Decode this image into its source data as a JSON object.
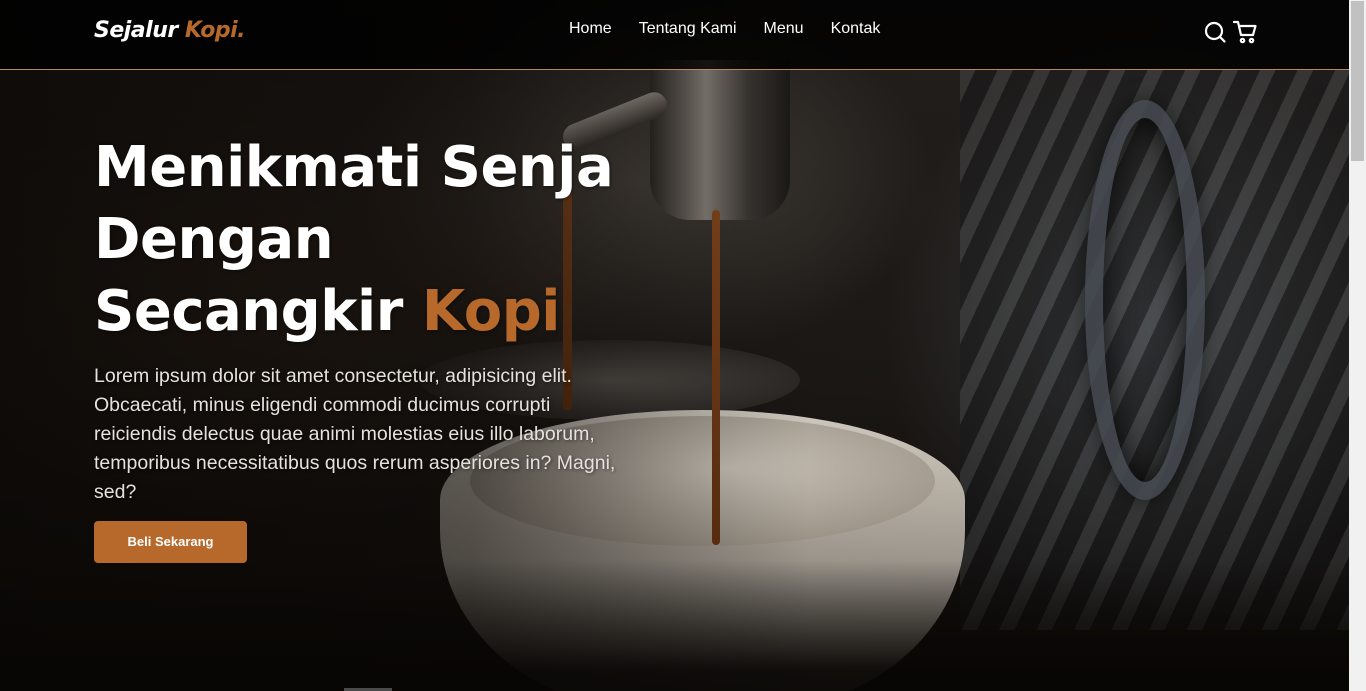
{
  "navbar": {
    "brand": {
      "main": "Sejalur",
      "accent": "Kopi."
    },
    "links": [
      {
        "label": "Home"
      },
      {
        "label": "Tentang Kami"
      },
      {
        "label": "Menu"
      },
      {
        "label": "Kontak"
      }
    ],
    "icons": [
      "search-icon",
      "shopping-cart-icon"
    ]
  },
  "hero": {
    "headline_line1": "Menikmati Senja",
    "headline_line2": "Dengan",
    "headline_line3_main": "Secangkir",
    "headline_line3_accent": "Kopi",
    "lead": "Lorem ipsum dolor sit amet consectetur, adipisicing elit. Obcaecati, minus eligendi commodi ducimus corrupti reiciendis delectus quae animi molestias eius illo laborum, temporibus necessitatibus quos rerum asperiores in? Magni, sed?",
    "cta_label": "Beli Sekarang",
    "background": "espresso-machine-pouring-coffee-image"
  },
  "colors": {
    "accent": "#b6692a",
    "navbar_border": "#b6895b",
    "text": "#ffffff"
  }
}
